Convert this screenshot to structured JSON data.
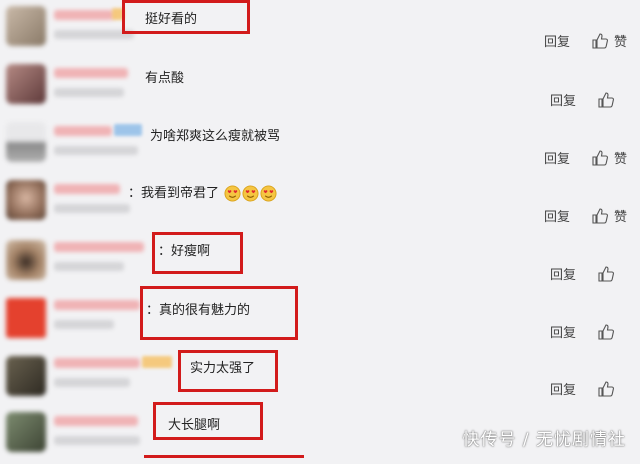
{
  "comments": [
    {
      "text": "挺好看的",
      "reply": "回复",
      "like": "赞"
    },
    {
      "text": "有点酸",
      "reply": "回复",
      "like": ""
    },
    {
      "text": "为啥郑爽这么瘦就被骂",
      "reply": "回复",
      "like": "赞"
    },
    {
      "text": "：我看到帝君了",
      "reply": "回复",
      "like": "赞"
    },
    {
      "text": "：好瘦啊",
      "reply": "回复",
      "like": ""
    },
    {
      "text": "：真的很有魅力的",
      "reply": "回复",
      "like": ""
    },
    {
      "text": "实力太强了",
      "reply": "回复",
      "like": ""
    },
    {
      "text": "大长腿啊",
      "reply": "",
      "like": ""
    }
  ],
  "emoji_icon": "heart-eyes-face-icon",
  "watermark": "快传号 / 无忧剧情社",
  "colors": {
    "highlight": "#d21b1b",
    "background": "#f2f2f4"
  }
}
